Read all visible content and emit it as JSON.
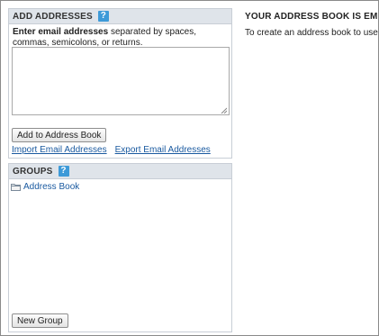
{
  "add_addresses": {
    "heading": "ADD ADDRESSES",
    "help_icon": "?",
    "instructions_bold": "Enter email addresses",
    "instructions_rest": " separated by spaces, commas, semicolons, or returns.",
    "textarea_value": "",
    "add_button": "Add to Address Book",
    "import_link": "Import Email Addresses",
    "export_link": "Export Email Addresses"
  },
  "groups": {
    "heading": "GROUPS",
    "help_icon": "?",
    "items": [
      {
        "label": "Address Book",
        "icon": "folder-icon"
      }
    ],
    "new_group_button": "New Group"
  },
  "address_book": {
    "empty_title": "YOUR ADDRESS BOOK IS EMPTY.",
    "empty_text": "To create an address book to use for"
  },
  "colors": {
    "header_bg": "#dfe4ea",
    "panel_border": "#c8ced6",
    "link": "#1a5aa0",
    "help_icon": "#3d9ad8"
  }
}
